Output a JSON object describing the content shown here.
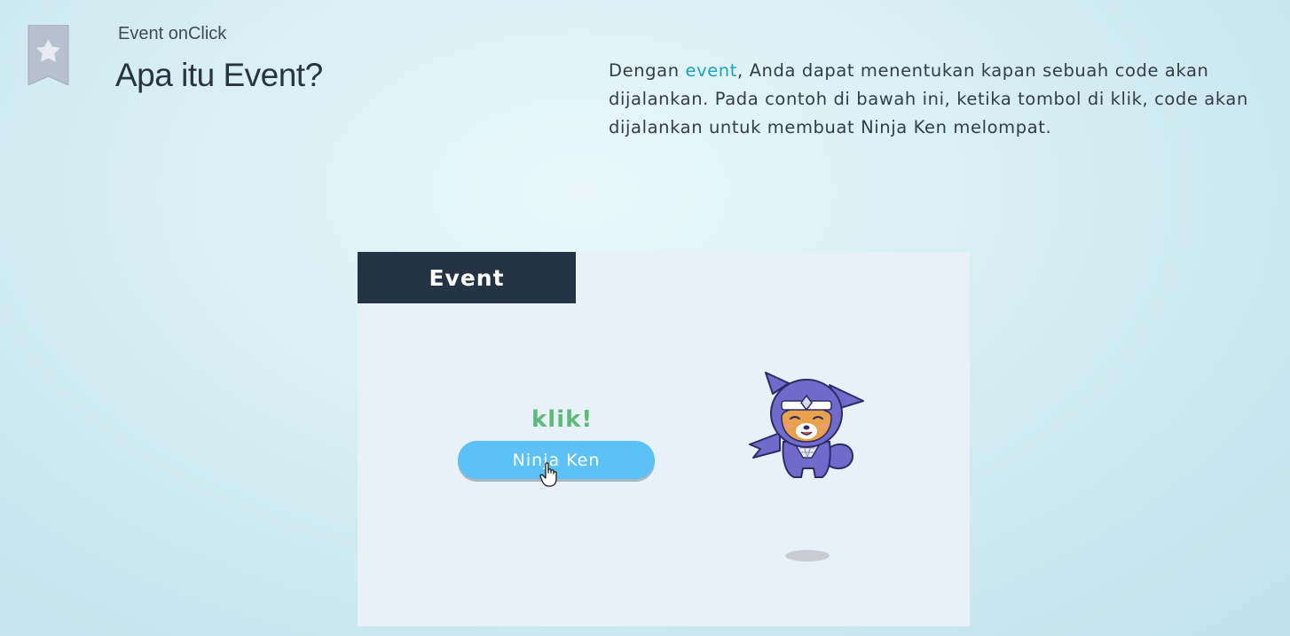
{
  "header": {
    "subtitle": "Event onClick",
    "title": "Apa itu Event?",
    "bookmark_icon": "star-bookmark-icon"
  },
  "description": {
    "before": "Dengan ",
    "keyword": "event",
    "after": ", Anda dapat menentukan kapan sebuah code akan dijalankan. Pada contoh di bawah ini, ketika tombol di klik, code akan dijalankan untuk membuat Ninja Ken melompat."
  },
  "illustration": {
    "tab_label": "Event",
    "click_label": "klik!",
    "button_label": "Ninja Ken",
    "character_icon": "ninja-ken-icon",
    "cursor_icon": "hand-cursor-icon"
  },
  "colors": {
    "keyword": "#1aa1c4",
    "tab_bg": "#243445",
    "button_bg": "#5bc1f6",
    "klik": "#5dba7a",
    "ninja": "#6f6bcb"
  }
}
